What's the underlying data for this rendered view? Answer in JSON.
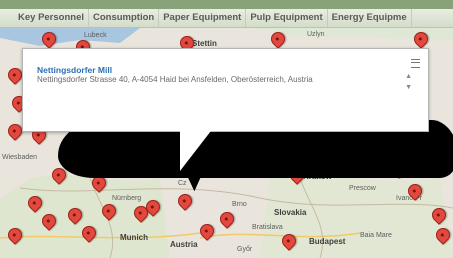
{
  "tabs": [
    "Key Personnel",
    "Consumption",
    "Paper Equipment",
    "Pulp Equipment",
    "Energy Equipme"
  ],
  "map": {
    "labels": {
      "lubeck": "Lubeck",
      "stettin": "Stettin",
      "uzlyn": "Uzlyn",
      "wiesbaden": "Wiesbaden",
      "krakow": "Krakow",
      "prescow": "Prescow",
      "nurnberg": "Nürnberg",
      "brno": "Brno",
      "slovakia": "Slovakia",
      "ivano": "Ivano-Fr",
      "munich": "Munich",
      "austria": "Austria",
      "bratislava": "Bratislava",
      "budapest": "Budapest",
      "baia_mare": "Baia Mare",
      "gyor": "Győr",
      "cz": "Cz"
    }
  },
  "info_window": {
    "title": "Nettingsdorfer Mill",
    "address": "Nettingsdorfer Strasse 40, A-4054 Haid bei Ansfelden, Oberösterreich, Austria",
    "close_icon": "close-icon",
    "scroll_up": "▲",
    "scroll_down": "▼"
  },
  "colors": {
    "tab_bg": "#d3dcc9",
    "title": "#2b6fb6",
    "pin": "#e1493e",
    "map_bg": "#e9e5dc"
  }
}
